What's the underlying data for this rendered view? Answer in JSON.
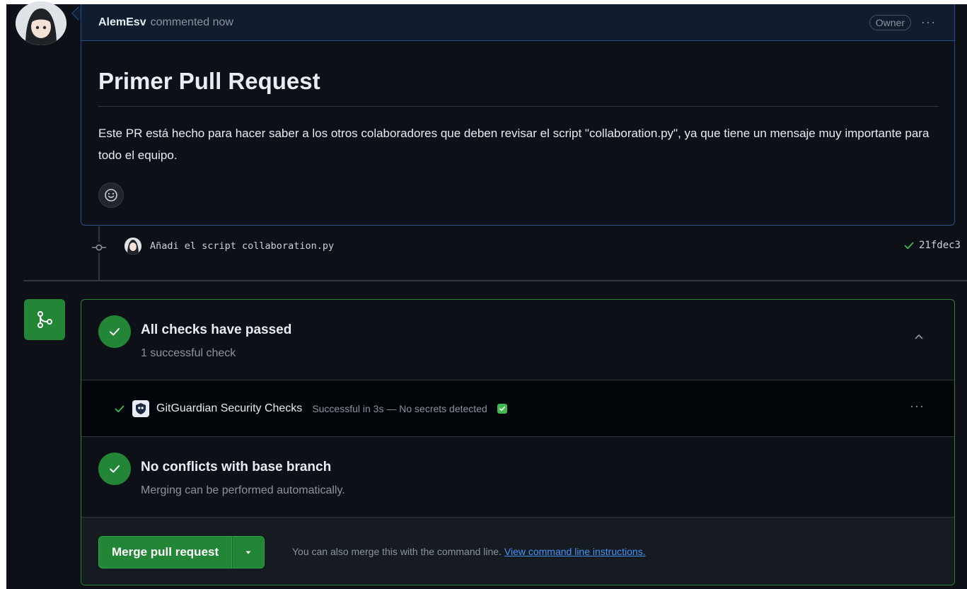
{
  "comment": {
    "author": "AlemEsv",
    "action": "commented now",
    "badge": "Owner",
    "title": "Primer Pull Request",
    "body": "Este PR está hecho para hacer saber a los otros colaboradores que deben revisar el script \"collaboration.py\", ya que tiene un mensaje muy importante para todo el equipo."
  },
  "commit": {
    "message": "Añadi el script collaboration.py",
    "sha": "21fdec3"
  },
  "checks": {
    "title": "All checks have passed",
    "subtitle": "1 successful check",
    "items": [
      {
        "name": "GitGuardian Security Checks",
        "status": "Successful in 3s — No secrets detected"
      }
    ]
  },
  "conflicts": {
    "title": "No conflicts with base branch",
    "subtitle": "Merging can be performed automatically."
  },
  "merge": {
    "button_label": "Merge pull request",
    "hint": "You can also merge this with the command line.",
    "link": "View command line instructions."
  },
  "icons": {
    "avatar": "avatar-anime",
    "commit": "git-commit-icon",
    "check": "check-icon",
    "merge": "git-merge-icon",
    "chevron": "chevron-up-icon",
    "emoji": "smiley-icon",
    "kebab": "kebab-horizontal-icon"
  },
  "colors": {
    "background": "#0d1117",
    "accent_green": "#238636",
    "link_blue": "#4493f8",
    "header_border": "#1f4f8c"
  }
}
